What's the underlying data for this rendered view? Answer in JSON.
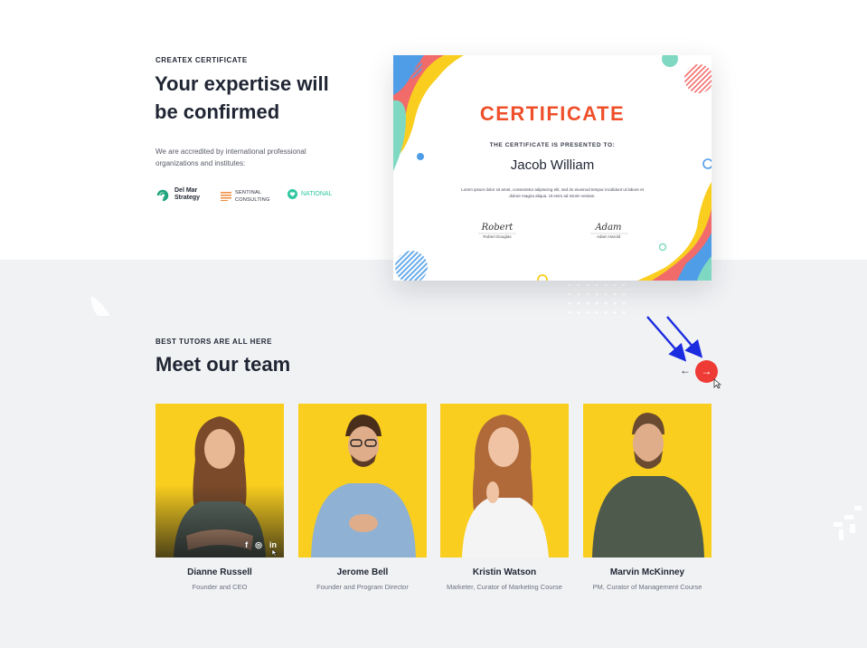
{
  "certificate_section": {
    "eyebrow": "CREATEX CERTIFICATE",
    "headline_line1": "Your expertise will",
    "headline_line2": "be confirmed",
    "description_line1": "We are accredited by international professional",
    "description_line2": "organizations and institutes:",
    "partners": [
      {
        "name": "Del Mar\nStrategy",
        "icon": "del-mar-logo-icon",
        "color": "#1aa37a"
      },
      {
        "name": "SENTINAL\nCONSULTING",
        "icon": "sentinal-logo-icon",
        "color": "#f08a3a"
      },
      {
        "name": "NATIONAL",
        "icon": "national-logo-icon",
        "color": "#2ec7a0"
      }
    ]
  },
  "certificate": {
    "title": "CERTIFICATE",
    "subtitle": "THE CERTIFICATE IS PRESENTED TO:",
    "recipient": "Jacob William",
    "lorem": "Lorem ipsum dolor sit amet, consectetur adipiscing elit, sed do eiusmod tempor incididunt ut labore et dolore magna aliqua. Ut enim ad minim veniam.",
    "signatures": [
      {
        "script": "Robert",
        "printed": "Robert Douglas"
      },
      {
        "script": "Adam",
        "printed": "Adam Harold"
      }
    ],
    "colors": {
      "title": "#ef4f2a",
      "yellow": "#f9ce1f",
      "blue": "#4f9de6",
      "coral": "#f26b6b",
      "mint": "#7fd9c2"
    }
  },
  "team_section": {
    "eyebrow": "BEST TUTORS ARE ALL HERE",
    "headline": "Meet our team",
    "prev_arrow": "←",
    "next_arrow": "→",
    "members": [
      {
        "name": "Dianne Russell",
        "role": "Founder and CEO",
        "hovered": true
      },
      {
        "name": "Jerome Bell",
        "role": "Founder and Program Director",
        "hovered": false
      },
      {
        "name": "Kristin Watson",
        "role": "Marketer, Curator of Marketing Course",
        "hovered": false
      },
      {
        "name": "Marvin McKinney",
        "role": "PM, Curator of Management Course",
        "hovered": false
      }
    ],
    "socials": [
      "f",
      "◎",
      "in"
    ],
    "accent": "#ef3b35",
    "card_bg": "#f9ce1f"
  }
}
